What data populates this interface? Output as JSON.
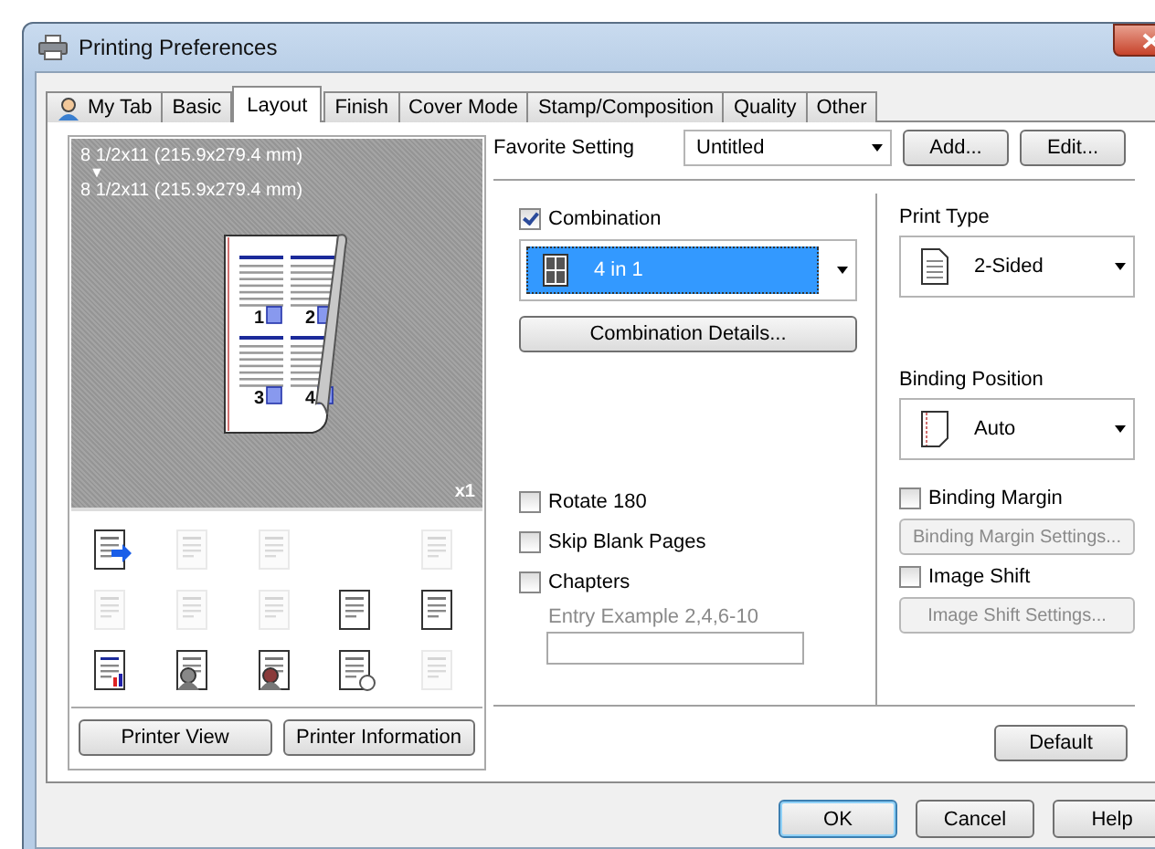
{
  "window": {
    "title": "Printing Preferences"
  },
  "tabs": [
    {
      "label": "My Tab",
      "selected": false,
      "kind": "user"
    },
    {
      "label": "Basic",
      "selected": false,
      "kind": "plain"
    },
    {
      "label": "Layout",
      "selected": true,
      "kind": "plain"
    },
    {
      "label": "Finish",
      "selected": false,
      "kind": "plain"
    },
    {
      "label": "Cover Mode",
      "selected": false,
      "kind": "plain"
    },
    {
      "label": "Stamp/Composition",
      "selected": false,
      "kind": "plain"
    },
    {
      "label": "Quality",
      "selected": false,
      "kind": "plain"
    },
    {
      "label": "Other",
      "selected": false,
      "kind": "plain"
    }
  ],
  "preview": {
    "original_size": "8 1/2x11 (215.9x279.4 mm)",
    "arrow": "▼",
    "output_size": "8 1/2x11 (215.9x279.4 mm)",
    "page_numbers": [
      "1",
      "2",
      "3",
      "4"
    ],
    "copies": "x1"
  },
  "function_icons": [
    {
      "kind": "icon",
      "disabled": false
    },
    {
      "kind": "icon",
      "disabled": true
    },
    {
      "kind": "icon",
      "disabled": true
    },
    {
      "kind": "blank"
    },
    {
      "kind": "icon",
      "disabled": true
    },
    {
      "kind": "icon",
      "disabled": true
    },
    {
      "kind": "icon",
      "disabled": true
    },
    {
      "kind": "icon",
      "disabled": true
    },
    {
      "kind": "icon",
      "disabled": false
    },
    {
      "kind": "icon",
      "disabled": false
    },
    {
      "kind": "icon",
      "disabled": false
    },
    {
      "kind": "icon",
      "disabled": false
    },
    {
      "kind": "icon",
      "disabled": false
    },
    {
      "kind": "icon",
      "disabled": false
    },
    {
      "kind": "icon",
      "disabled": true
    }
  ],
  "preview_buttons": [
    "Printer View",
    "Printer Information"
  ],
  "favorite": {
    "label": "Favorite Setting",
    "value": "Untitled",
    "buttons": [
      "Add...",
      "Edit..."
    ]
  },
  "combination": {
    "label": "Combination",
    "checked": true,
    "value": "4 in 1",
    "details_button": "Combination Details..."
  },
  "left_options": [
    {
      "label": "Rotate 180",
      "checked": false
    },
    {
      "label": "Skip Blank Pages",
      "checked": false
    },
    {
      "label": "Chapters",
      "checked": false
    }
  ],
  "chapters_entry": {
    "label": "Entry Example 2,4,6-10",
    "disabled": true
  },
  "print_type": {
    "label": "Print Type",
    "value": "2-Sided"
  },
  "binding_position": {
    "label": "Binding Position",
    "value": "Auto"
  },
  "right_options": [
    {
      "label": "Binding Margin",
      "checked": false,
      "button": "Binding Margin Settings...",
      "disabled": true
    },
    {
      "label": "Image Shift",
      "checked": false,
      "button": "Image Shift Settings...",
      "disabled": true
    }
  ],
  "default_button": "Default",
  "dialog_buttons": [
    {
      "label": "OK",
      "kind": "default"
    },
    {
      "label": "Cancel",
      "kind": "normal"
    },
    {
      "label": "Help",
      "kind": "normal"
    }
  ]
}
